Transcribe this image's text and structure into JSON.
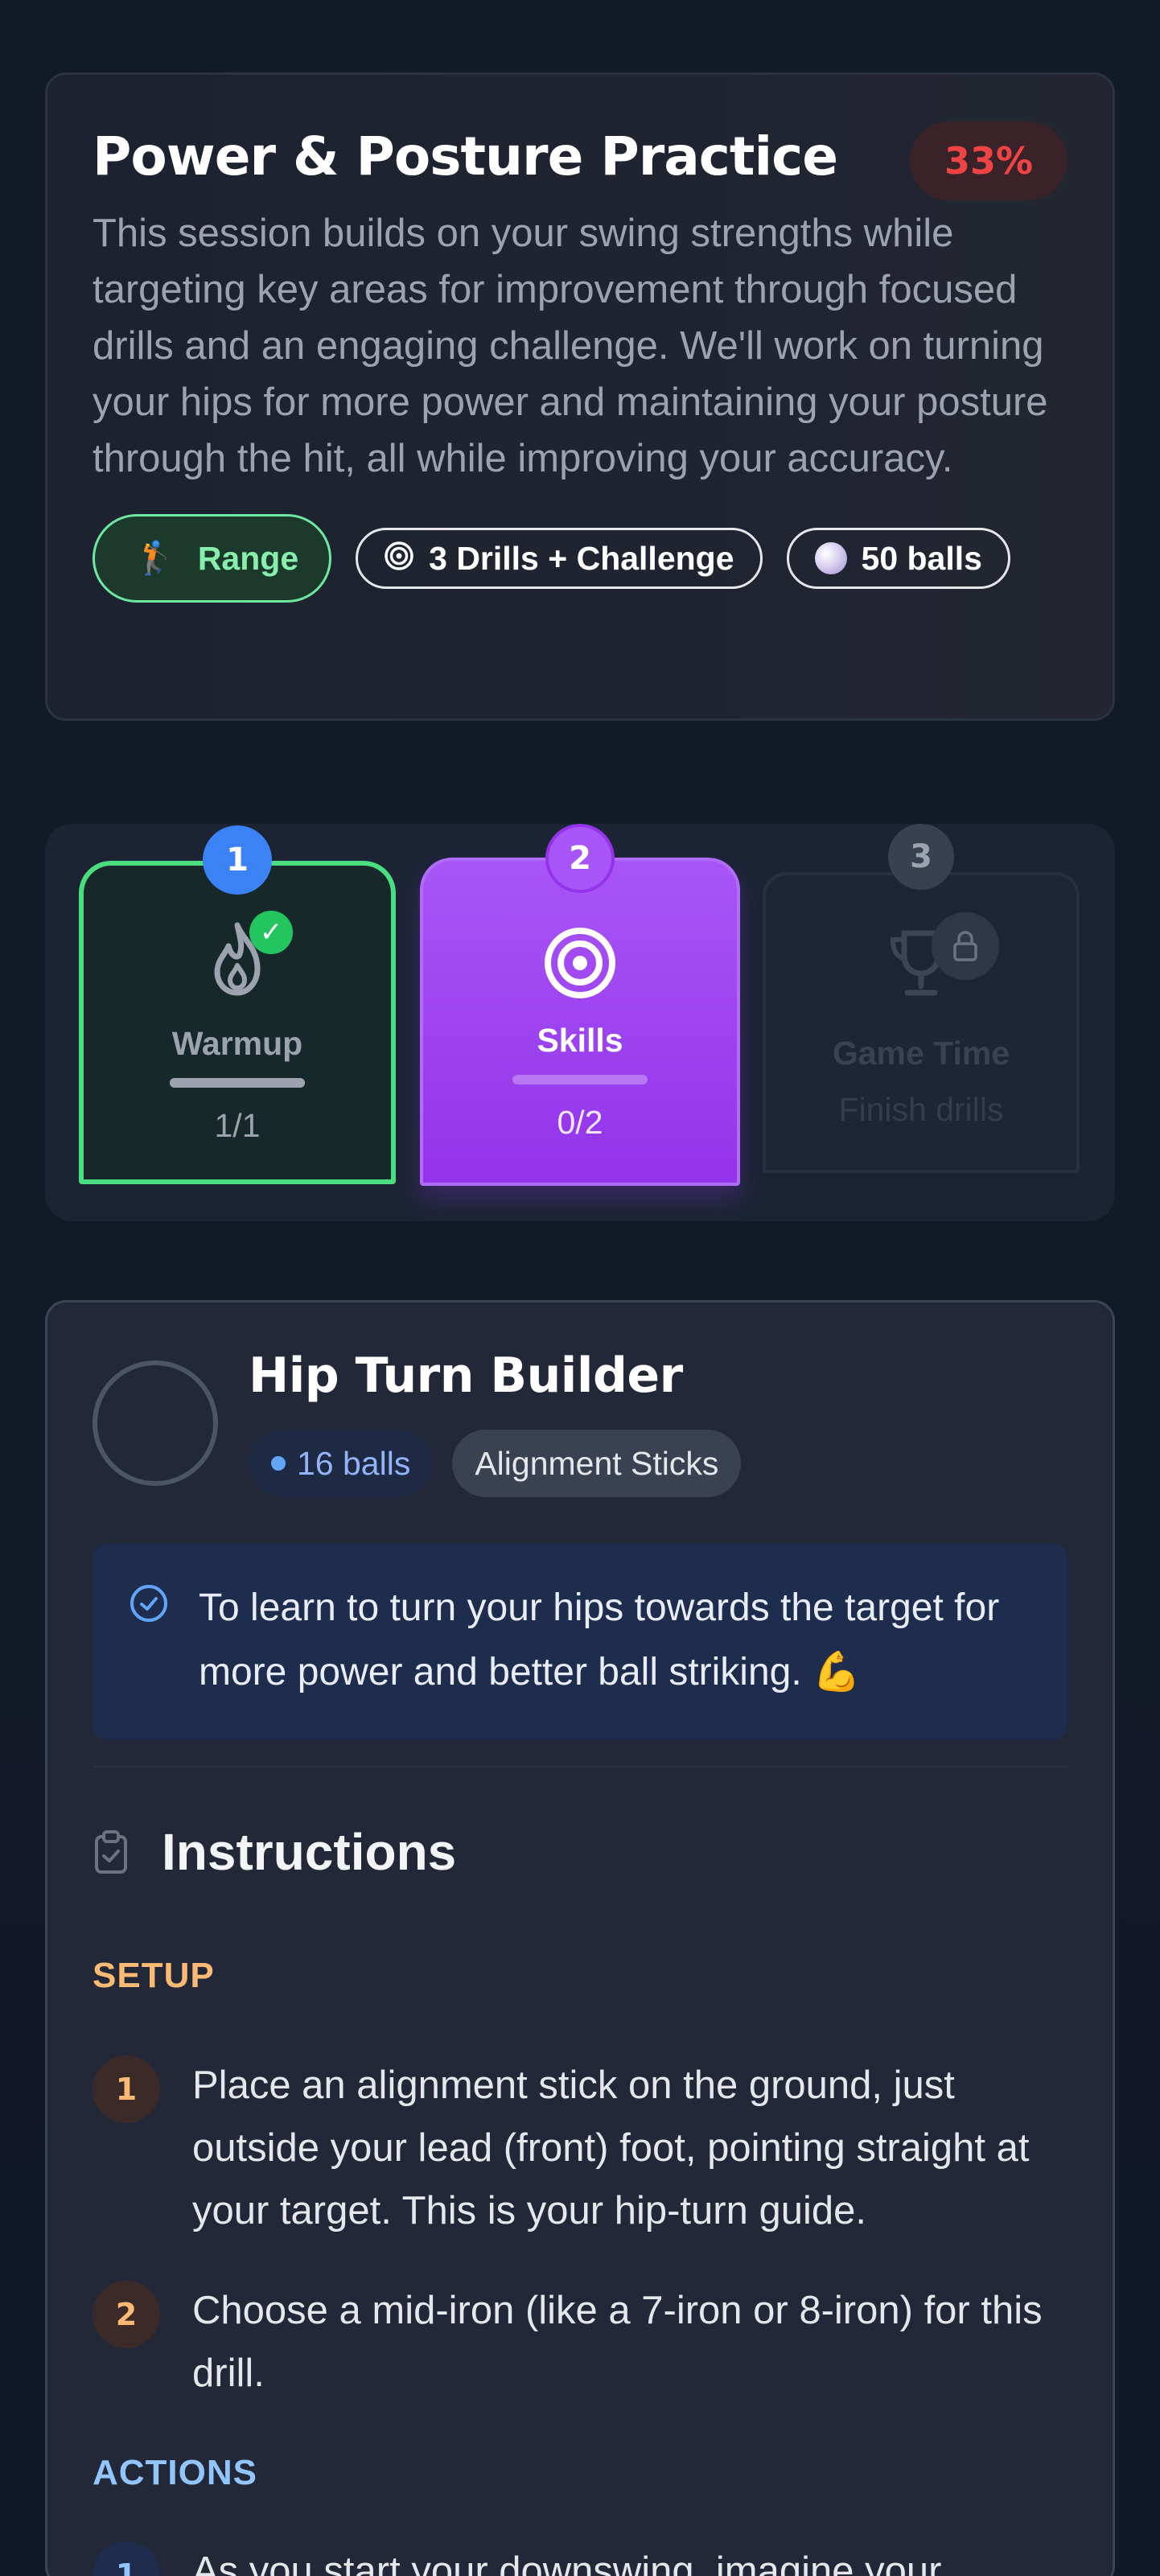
{
  "session": {
    "title": "Power & Posture Practice",
    "progress_percent": 33,
    "progress_label": "33%",
    "description": "This session builds on your swing strengths while targeting key areas for improvement through focused drills and an engaging challenge. We'll work on turning your hips for more power and maintaining your posture through the hit, all while improving your accuracy.",
    "chips": {
      "location": {
        "icon": "golfer-icon",
        "glyph": "🏌",
        "label": "Range"
      },
      "drills": {
        "icon": "target-icon",
        "glyph": "◎",
        "label": "3 Drills + Challenge"
      },
      "balls": {
        "icon": "golf-ball-icon",
        "label": "50 balls"
      }
    },
    "colors": {
      "range_chip": "#86efac",
      "percent_badge": "#ef4444"
    }
  },
  "stages": [
    {
      "number": "1",
      "label": "Warmup",
      "count": "1/1",
      "progress": 1.0,
      "state": "completed",
      "icon": "flame-icon",
      "status_icon": "check-icon",
      "status_glyph": "✓"
    },
    {
      "number": "2",
      "label": "Skills",
      "count": "0/2",
      "progress": 0.0,
      "state": "active",
      "icon": "target-icon"
    },
    {
      "number": "3",
      "label": "Game Time",
      "count": "Finish drills",
      "state": "locked",
      "icon": "trophy-icon",
      "status_icon": "lock-icon"
    }
  ],
  "drill": {
    "title": "Hip Turn Builder",
    "balls_label": "16 balls",
    "equipment_label": "Alignment Sticks",
    "goal": "To learn to turn your hips towards the target for more power and better ball striking. 💪",
    "instructions_title": "Instructions",
    "setup_label": "SETUP",
    "setup_steps": [
      {
        "number": "1",
        "text": "Place an alignment stick on the ground, just outside your lead (front) foot, pointing straight at your target. This is your hip-turn guide."
      },
      {
        "number": "2",
        "text": "Choose a mid-iron (like a 7-iron or 8-iron) for this drill."
      }
    ],
    "actions_label": "ACTIONS",
    "action_steps": [
      {
        "number": "1",
        "text": "As you start your downswing, imagine your"
      }
    ],
    "colors": {
      "setup_accent": "#fdba74",
      "actions_accent": "#93c5fd"
    }
  }
}
